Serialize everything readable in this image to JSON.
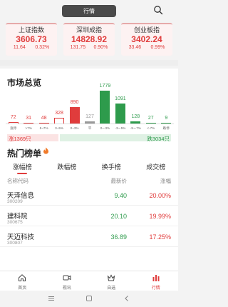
{
  "header": {
    "tab_label": "行情"
  },
  "indices": [
    {
      "name": "上证指数",
      "value": "3606.73",
      "change": "11.64",
      "pct": "0.32%"
    },
    {
      "name": "深圳成指",
      "value": "14828.92",
      "change": "131.75",
      "pct": "0.90%"
    },
    {
      "name": "创业板指",
      "value": "3402.24",
      "change": "33.46",
      "pct": "0.99%"
    }
  ],
  "market": {
    "title": "市场总览",
    "up_label": "涨1369只",
    "down_label": "跌3034只",
    "up_count": 1369,
    "down_count": 3034,
    "bars": [
      {
        "label": "涨停",
        "value": 72,
        "color": "#e03c3c",
        "kind": "up"
      },
      {
        "label": ">7%",
        "value": 31,
        "color": "#e03c3c",
        "kind": "up"
      },
      {
        "label": "5~7%",
        "value": 48,
        "color": "#e03c3c",
        "kind": "up"
      },
      {
        "label": "3~5%",
        "value": 328,
        "color": "#e03c3c",
        "kind": "up"
      },
      {
        "label": "0~3%",
        "value": 890,
        "color": "#e03c3c",
        "kind": "up"
      },
      {
        "label": "平",
        "value": 127,
        "color": "#999999",
        "kind": "flat"
      },
      {
        "label": "0~-3%",
        "value": 1779,
        "color": "#2e9b4c",
        "kind": "down"
      },
      {
        "label": "-3~-5%",
        "value": 1091,
        "color": "#2e9b4c",
        "kind": "down"
      },
      {
        "label": "-5~-7%",
        "value": 128,
        "color": "#2e9b4c",
        "kind": "down"
      },
      {
        "label": "<-7%",
        "value": 27,
        "color": "#2e9b4c",
        "kind": "down"
      },
      {
        "label": "跌停",
        "value": 9,
        "color": "#2e9b4c",
        "kind": "down"
      }
    ]
  },
  "hot": {
    "title": "热门榜单",
    "tabs": [
      "涨幅榜",
      "跌幅榜",
      "换手榜",
      "成交榜"
    ],
    "col_name": "名称代码",
    "col_price": "最新价",
    "col_pct": "涨幅",
    "rows": [
      {
        "name": "天泽信息",
        "code": "300209",
        "price": "9.40",
        "pct": "20.00%"
      },
      {
        "name": "建科院",
        "code": "300675",
        "price": "20.10",
        "pct": "19.99%"
      },
      {
        "name": "天迈科技",
        "code": "300807",
        "price": "36.89",
        "pct": "17.25%"
      }
    ]
  },
  "nav": {
    "items": [
      {
        "label": "首页"
      },
      {
        "label": "视讯"
      },
      {
        "label": "自选"
      },
      {
        "label": "行情"
      }
    ]
  },
  "colors": {
    "up": "#e03c3c",
    "down": "#2e9b4c",
    "flat": "#999999",
    "accent": "#e03c3c"
  }
}
